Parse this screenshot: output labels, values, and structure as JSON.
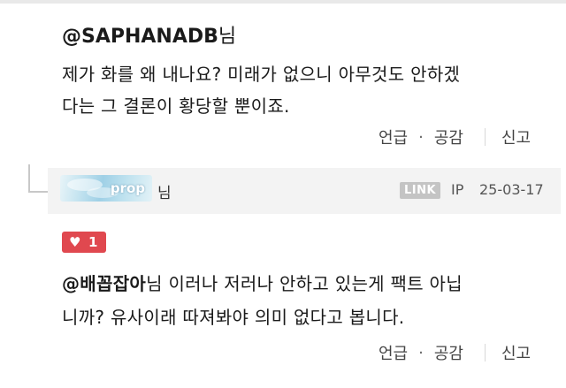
{
  "comment1": {
    "mention_handle": "@SAPHANADB",
    "mention_suffix": "님",
    "body_line1": "제가 화를 왜 내나요? 미래가 없으니 아무것도 안하겠",
    "body_line2": "다는 그 결론이 황당할 뿐이죠.",
    "actions": {
      "reply": "언급",
      "dot": "·",
      "like": "공감",
      "report": "신고"
    }
  },
  "reply": {
    "username": "prop",
    "honorific": "님",
    "link_badge": "LINK",
    "ip_label": "IP",
    "date": "25-03-17",
    "like_icon": "heart-icon",
    "like_count": "1",
    "mention_handle": "@배꼽잡아",
    "body_line1_rest": "님 이러나 저러나 안하고 있는게 팩트 아닙",
    "body_line2": "니까? 유사이래 따져봐야 의미 없다고 봅니다.",
    "actions": {
      "reply": "언급",
      "dot": "·",
      "like": "공감",
      "report": "신고"
    }
  },
  "colors": {
    "like_badge": "#e0484f",
    "header_bg": "#f3f3f3",
    "link_badge": "#c4c4c4"
  }
}
